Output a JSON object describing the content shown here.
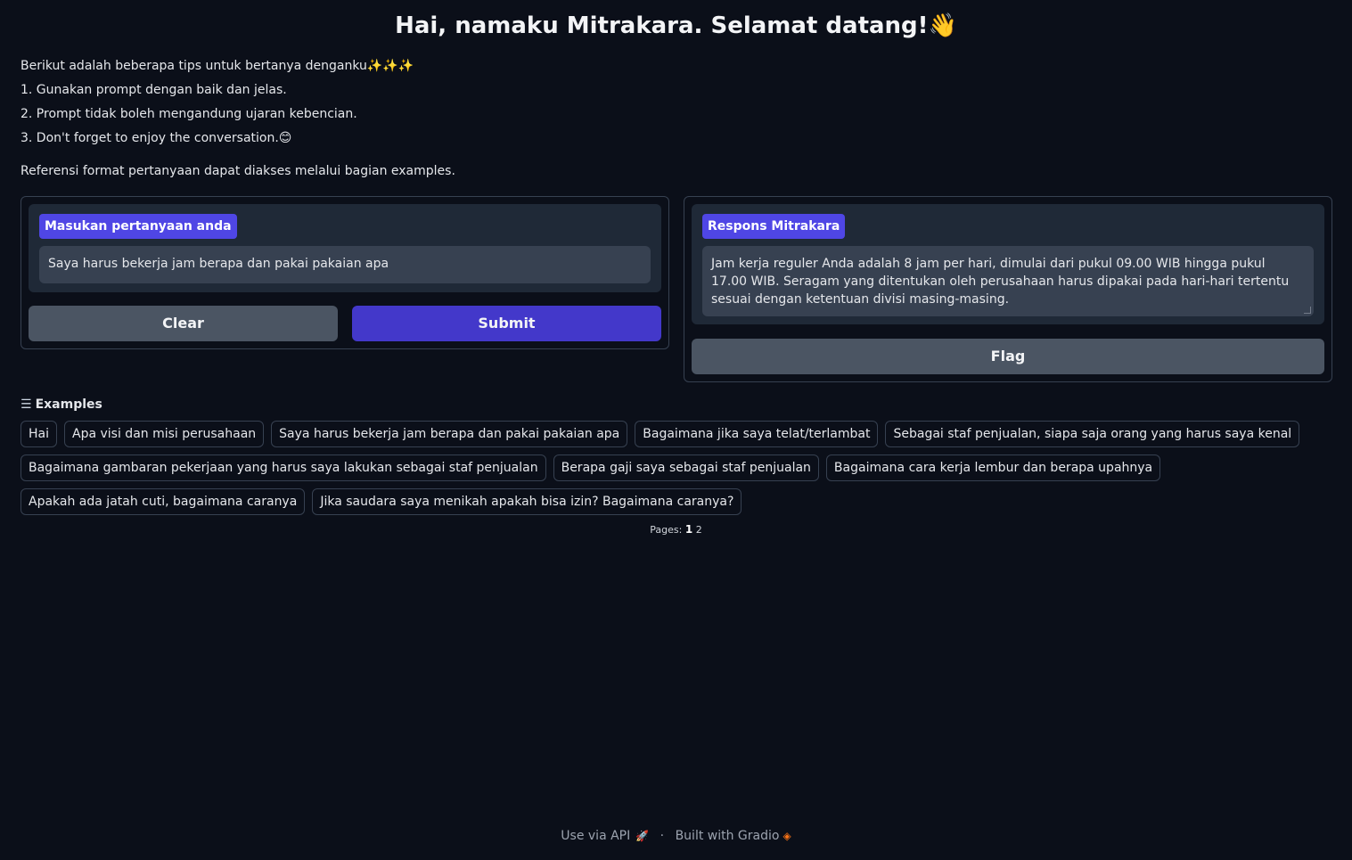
{
  "header": {
    "title": "Hai, namaku Mitrakara. Selamat datang!",
    "title_emoji": "👋"
  },
  "intro": {
    "lead": "Berikut adalah beberapa tips untuk bertanya denganku",
    "lead_emoji": "✨✨✨",
    "tips": [
      "1. Gunakan prompt dengan baik dan jelas.",
      "2. Prompt tidak boleh mengandung ujaran kebencian.",
      "3. Don't forget to enjoy the conversation."
    ],
    "tip3_emoji": "😊",
    "reference": "Referensi format pertanyaan dapat diakses melalui bagian examples."
  },
  "input_panel": {
    "label": "Masukan pertanyaan anda",
    "value": "Saya harus bekerja jam berapa dan pakai pakaian apa",
    "clear_label": "Clear",
    "submit_label": "Submit"
  },
  "output_panel": {
    "label": "Respons Mitrakara",
    "value": "Jam kerja reguler Anda adalah 8 jam per hari, dimulai dari pukul 09.00 WIB hingga pukul 17.00 WIB. Seragam yang ditentukan oleh perusahaan harus dipakai pada hari-hari tertentu sesuai dengan ketentuan divisi masing-masing.",
    "flag_label": "Flag"
  },
  "examples": {
    "heading": "Examples",
    "heading_icon": "list-icon",
    "rows": [
      [
        "Hai",
        "Apa visi dan misi perusahaan",
        "Saya harus bekerja jam berapa dan pakai pakaian apa",
        "Bagaimana jika saya telat/terlambat",
        "Sebagai staf penjualan, siapa saja orang yang harus saya kenal"
      ],
      [
        "Bagaimana gambaran pekerjaan yang harus saya lakukan sebagai staf penjualan",
        "Berapa gaji saya sebagai staf penjualan",
        "Bagaimana cara kerja lembur dan berapa upahnya"
      ],
      [
        "Apakah ada jatah cuti, bagaimana caranya",
        "Jika saudara saya menikah apakah bisa izin? Bagaimana caranya?"
      ]
    ],
    "pages_label": "Pages:",
    "current_page": "1",
    "other_page": "2"
  },
  "footer": {
    "api_label": "Use via API",
    "separator": "·",
    "built_label": "Built with Gradio"
  },
  "colors": {
    "background": "#0b0f19",
    "accent": "#4f46e5",
    "submit": "#4338ca",
    "secondary_button": "#4b5563"
  }
}
